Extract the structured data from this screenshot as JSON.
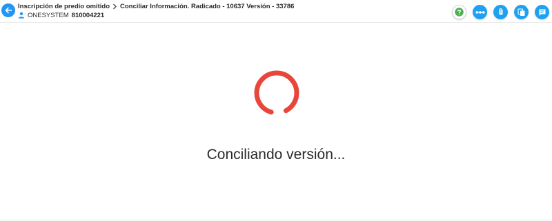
{
  "header": {
    "breadcrumb": {
      "parent": "Inscripción de predio omitido",
      "current": "Conciliar Información. Radicado - 10637 Versión - 33786"
    },
    "user": {
      "name": "ONESYSTEM",
      "id": "810004221"
    },
    "actions": [
      "help-icon",
      "workflow-icon",
      "attachment-icon",
      "copy-icon",
      "comment-icon"
    ]
  },
  "loading": {
    "message": "Conciliando versión..."
  },
  "colors": {
    "primary": "#1ea1f2",
    "help": "#4caf50",
    "spinner": "#e8463b"
  }
}
